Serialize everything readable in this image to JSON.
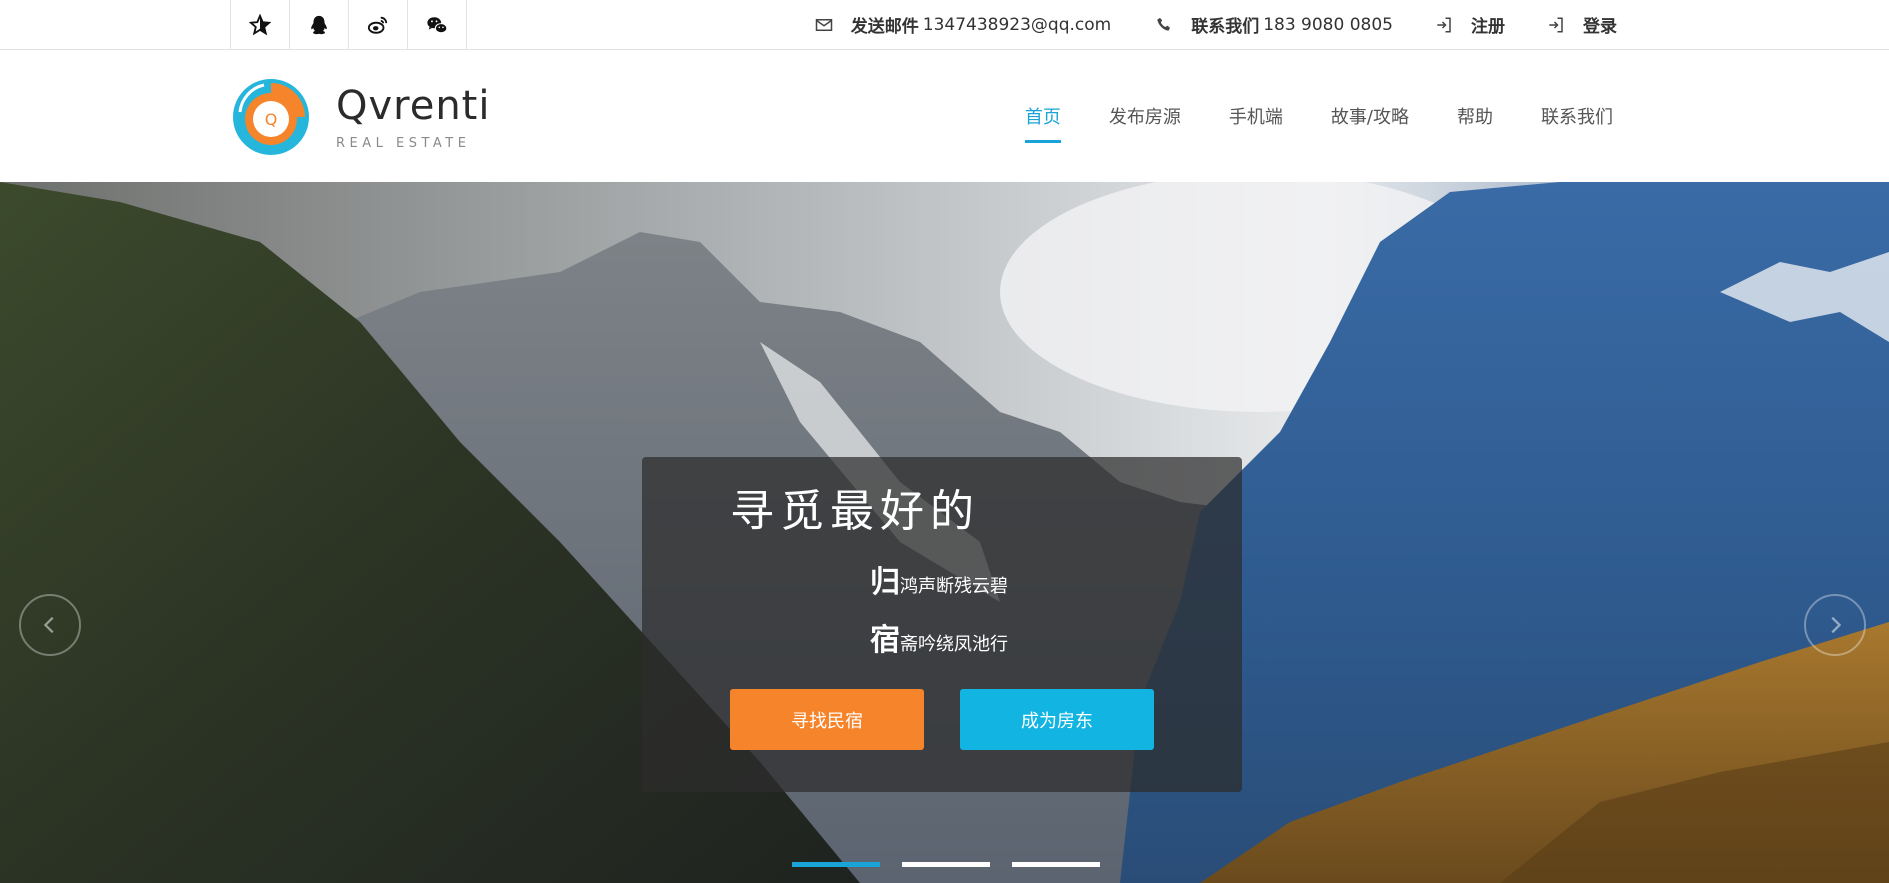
{
  "topbar": {
    "social": [
      {
        "icon": "star-icon"
      },
      {
        "icon": "qq-icon"
      },
      {
        "icon": "weibo-icon"
      },
      {
        "icon": "wechat-icon"
      }
    ],
    "email": {
      "label": "发送邮件",
      "value": "1347438923@qq.com",
      "icon": "mail-icon"
    },
    "phone": {
      "label": "联系我们",
      "value": "183 9080 0805",
      "icon": "phone-icon"
    },
    "register": {
      "label": "注册",
      "icon": "sign-in-icon"
    },
    "login": {
      "label": "登录",
      "icon": "sign-in-icon"
    }
  },
  "header": {
    "logo": {
      "name": "Qvrenti",
      "sub": "REAL ESTATE",
      "mark_letter": "Q"
    },
    "nav": [
      {
        "label": "首页",
        "active": true
      },
      {
        "label": "发布房源"
      },
      {
        "label": "手机端"
      },
      {
        "label": "故事/攻略"
      },
      {
        "label": "帮助"
      },
      {
        "label": "联系我们"
      }
    ]
  },
  "hero": {
    "title": "寻觅最好的",
    "lines": [
      {
        "big": "归",
        "rest": "鸿声断残云碧"
      },
      {
        "big": "宿",
        "rest": "斋吟绕凤池行"
      }
    ],
    "buttons": {
      "find": "寻找民宿",
      "host": "成为房东"
    },
    "slides": 3,
    "active_slide": 0
  },
  "colors": {
    "accent": "#1aa3d8",
    "orange": "#f6842a",
    "cyan": "#12b5e2"
  }
}
